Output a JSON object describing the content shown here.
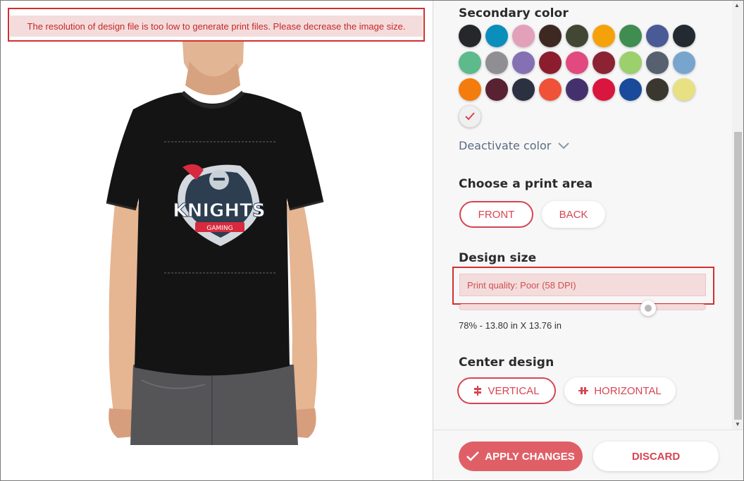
{
  "error_banner": {
    "text": "The resolution of design file is too low to generate print files. Please decrease the image size."
  },
  "design": {
    "logo_main": "KNIGHTS",
    "logo_sub": "GAMING"
  },
  "secondary_color": {
    "title": "Secondary color",
    "swatches": [
      "#26272b",
      "#0a8fbd",
      "#e3a1b9",
      "#3d2822",
      "#414733",
      "#f5a20a",
      "#3f8d51",
      "#4a5a97",
      "#242a32",
      "#5dba8b",
      "#8f8e93",
      "#8570b4",
      "#8c1d2e",
      "#e2497e",
      "#8b2332",
      "#9bd06d",
      "#56606f",
      "#78a5cd",
      "#f47c0c",
      "#582233",
      "#2b3140",
      "#ef5238",
      "#45306e",
      "#d9163d",
      "#1a4b9a",
      "#3a3630",
      "#e8e184"
    ],
    "selected_color": "#f0f0f0",
    "selected_check_color": "#d74452",
    "deactivate_label": "Deactivate color"
  },
  "print_area": {
    "title": "Choose a print area",
    "front": "FRONT",
    "back": "BACK"
  },
  "design_size": {
    "title": "Design size",
    "quality": "Print quality: Poor (58 DPI)",
    "slider_value_percent": 78,
    "size_text": "78% - 13.80 in X 13.76 in"
  },
  "center_design": {
    "title": "Center design",
    "vertical": "VERTICAL",
    "horizontal": "HORIZONTAL"
  },
  "footer": {
    "apply": "APPLY CHANGES",
    "discard": "DISCARD"
  },
  "colors": {
    "accent": "#d74452",
    "error_bg": "#f4dcdc",
    "error_text": "#c62828"
  }
}
